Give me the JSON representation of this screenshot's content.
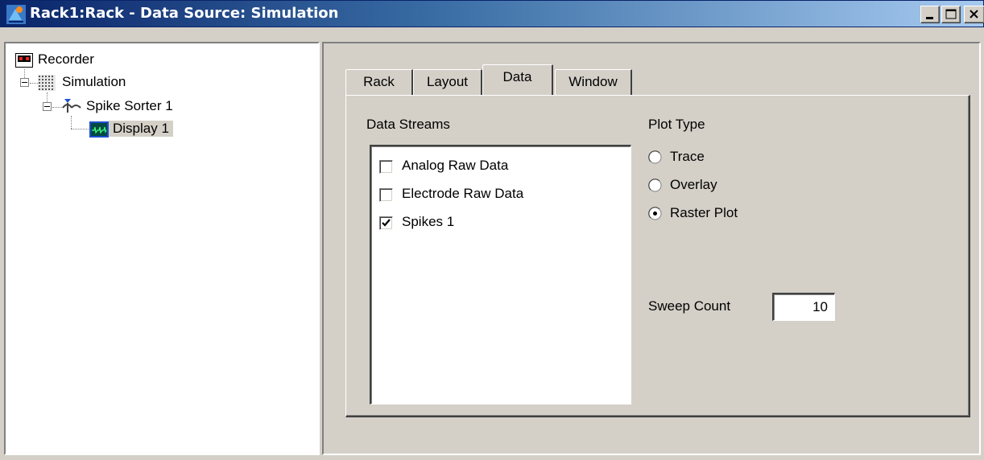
{
  "window": {
    "title": "Rack1:Rack - Data Source: Simulation",
    "controls": [
      "minimize",
      "maximize",
      "close"
    ]
  },
  "tree": {
    "items": [
      {
        "label": "Recorder",
        "icon": "recorder-icon"
      },
      {
        "label": "Simulation",
        "icon": "simulation-grid-icon"
      },
      {
        "label": "Spike Sorter 1",
        "icon": "spike-sorter-icon"
      },
      {
        "label": "Display 1",
        "icon": "display-icon",
        "selected": true
      }
    ]
  },
  "tabs": [
    "Rack",
    "Layout",
    "Data",
    "Window"
  ],
  "active_tab": "Data",
  "data_tab": {
    "data_streams_label": "Data Streams",
    "streams": [
      {
        "label": "Analog Raw Data",
        "checked": false
      },
      {
        "label": "Electrode Raw Data",
        "checked": false
      },
      {
        "label": "Spikes 1",
        "checked": true
      }
    ],
    "plot_type_label": "Plot Type",
    "plot_types": [
      {
        "label": "Trace",
        "selected": false
      },
      {
        "label": "Overlay",
        "selected": false
      },
      {
        "label": "Raster Plot",
        "selected": true
      }
    ],
    "sweep_count_label": "Sweep Count",
    "sweep_count_value": "10"
  }
}
